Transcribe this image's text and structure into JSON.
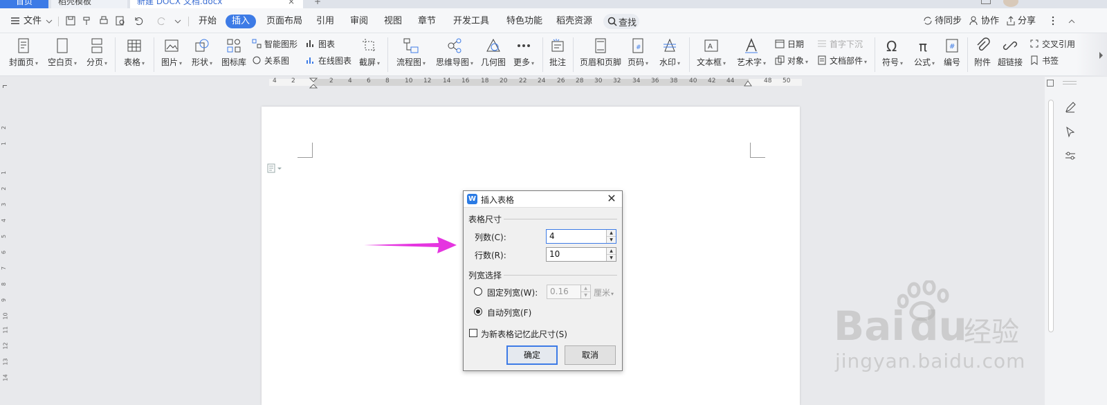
{
  "tabs": {
    "home": "首页",
    "templates": "稻壳模板",
    "document": "新建 DOCX 文档.docx",
    "close": "×",
    "new": "+"
  },
  "menu": {
    "file": "文件",
    "items": [
      "开始",
      "插入",
      "页面布局",
      "引用",
      "审阅",
      "视图",
      "章节",
      "开发工具",
      "特色功能",
      "稻壳资源"
    ],
    "active": "插入",
    "search": "查找",
    "right": [
      "待同步",
      "协作",
      "分享"
    ]
  },
  "ribbon": {
    "large": [
      {
        "id": "cover",
        "label": "封面页",
        "dd": true
      },
      {
        "id": "blank",
        "label": "空白页",
        "dd": true
      },
      {
        "id": "break",
        "label": "分页",
        "dd": true
      },
      {
        "id": "table",
        "label": "表格",
        "dd": true
      },
      {
        "id": "picture",
        "label": "图片",
        "dd": true
      },
      {
        "id": "shape",
        "label": "形状",
        "dd": true
      },
      {
        "id": "iconlib",
        "label": "图标库",
        "dd": false
      },
      {
        "id": "screenshot",
        "label": "截屏",
        "dd": true
      },
      {
        "id": "flowchart",
        "label": "流程图",
        "dd": true
      },
      {
        "id": "mindmap",
        "label": "思维导图",
        "dd": true
      },
      {
        "id": "geometry",
        "label": "几何图",
        "dd": false
      },
      {
        "id": "more",
        "label": "更多",
        "dd": true
      },
      {
        "id": "comment",
        "label": "批注",
        "dd": false
      },
      {
        "id": "headerfooter",
        "label": "页眉和页脚",
        "dd": false
      },
      {
        "id": "pagenum",
        "label": "页码",
        "dd": true
      },
      {
        "id": "watermark",
        "label": "水印",
        "dd": true
      },
      {
        "id": "textbox",
        "label": "文本框",
        "dd": true
      },
      {
        "id": "wordart",
        "label": "艺术字",
        "dd": true
      },
      {
        "id": "symbol",
        "label": "符号",
        "dd": true
      },
      {
        "id": "formula",
        "label": "公式",
        "dd": true
      },
      {
        "id": "numbering",
        "label": "编号",
        "dd": false
      },
      {
        "id": "attachment",
        "label": "附件",
        "dd": false
      },
      {
        "id": "hyperlink",
        "label": "超链接",
        "dd": false
      }
    ],
    "small": {
      "smartshape": "智能图形",
      "chart": "图表",
      "relation": "关系图",
      "onlinechart": "在线图表",
      "date": "日期",
      "dropcap": "首字下沉",
      "object": "对象",
      "docpart": "文档部件",
      "crossref": "交叉引用",
      "bookmark": "书签"
    }
  },
  "ruler": {
    "numbers": [
      "4",
      "2",
      "2",
      "4",
      "6",
      "8",
      "10",
      "12",
      "14",
      "16",
      "18",
      "20",
      "22",
      "24",
      "26",
      "28",
      "30",
      "32",
      "34",
      "36",
      "38",
      "40",
      "42",
      "44",
      "48",
      "50"
    ],
    "vertical": [
      "2",
      "1",
      "1",
      "2",
      "3",
      "4",
      "5",
      "6",
      "7",
      "8",
      "9",
      "10",
      "11",
      "12",
      "13",
      "14"
    ]
  },
  "dialog": {
    "title": "插入表格",
    "size_group": "表格尺寸",
    "cols_label": "列数(C):",
    "cols_value": "4",
    "rows_label": "行数(R):",
    "rows_value": "10",
    "width_group": "列宽选择",
    "fixed_label": "固定列宽(W):",
    "fixed_value": "0.16",
    "fixed_unit": "厘米",
    "auto_label": "自动列宽(F)",
    "remember_label": "为新表格记忆此尺寸(S)",
    "ok": "确定",
    "cancel": "取消",
    "selected_width": "auto",
    "remember_checked": false
  },
  "watermark": {
    "logo": "Bai",
    "logo2": "du",
    "jingyan": "经验",
    "url": "jingyan.baidu.com"
  },
  "colors": {
    "accent": "#3d7be6",
    "annotation_arrow": "#e535e0"
  }
}
